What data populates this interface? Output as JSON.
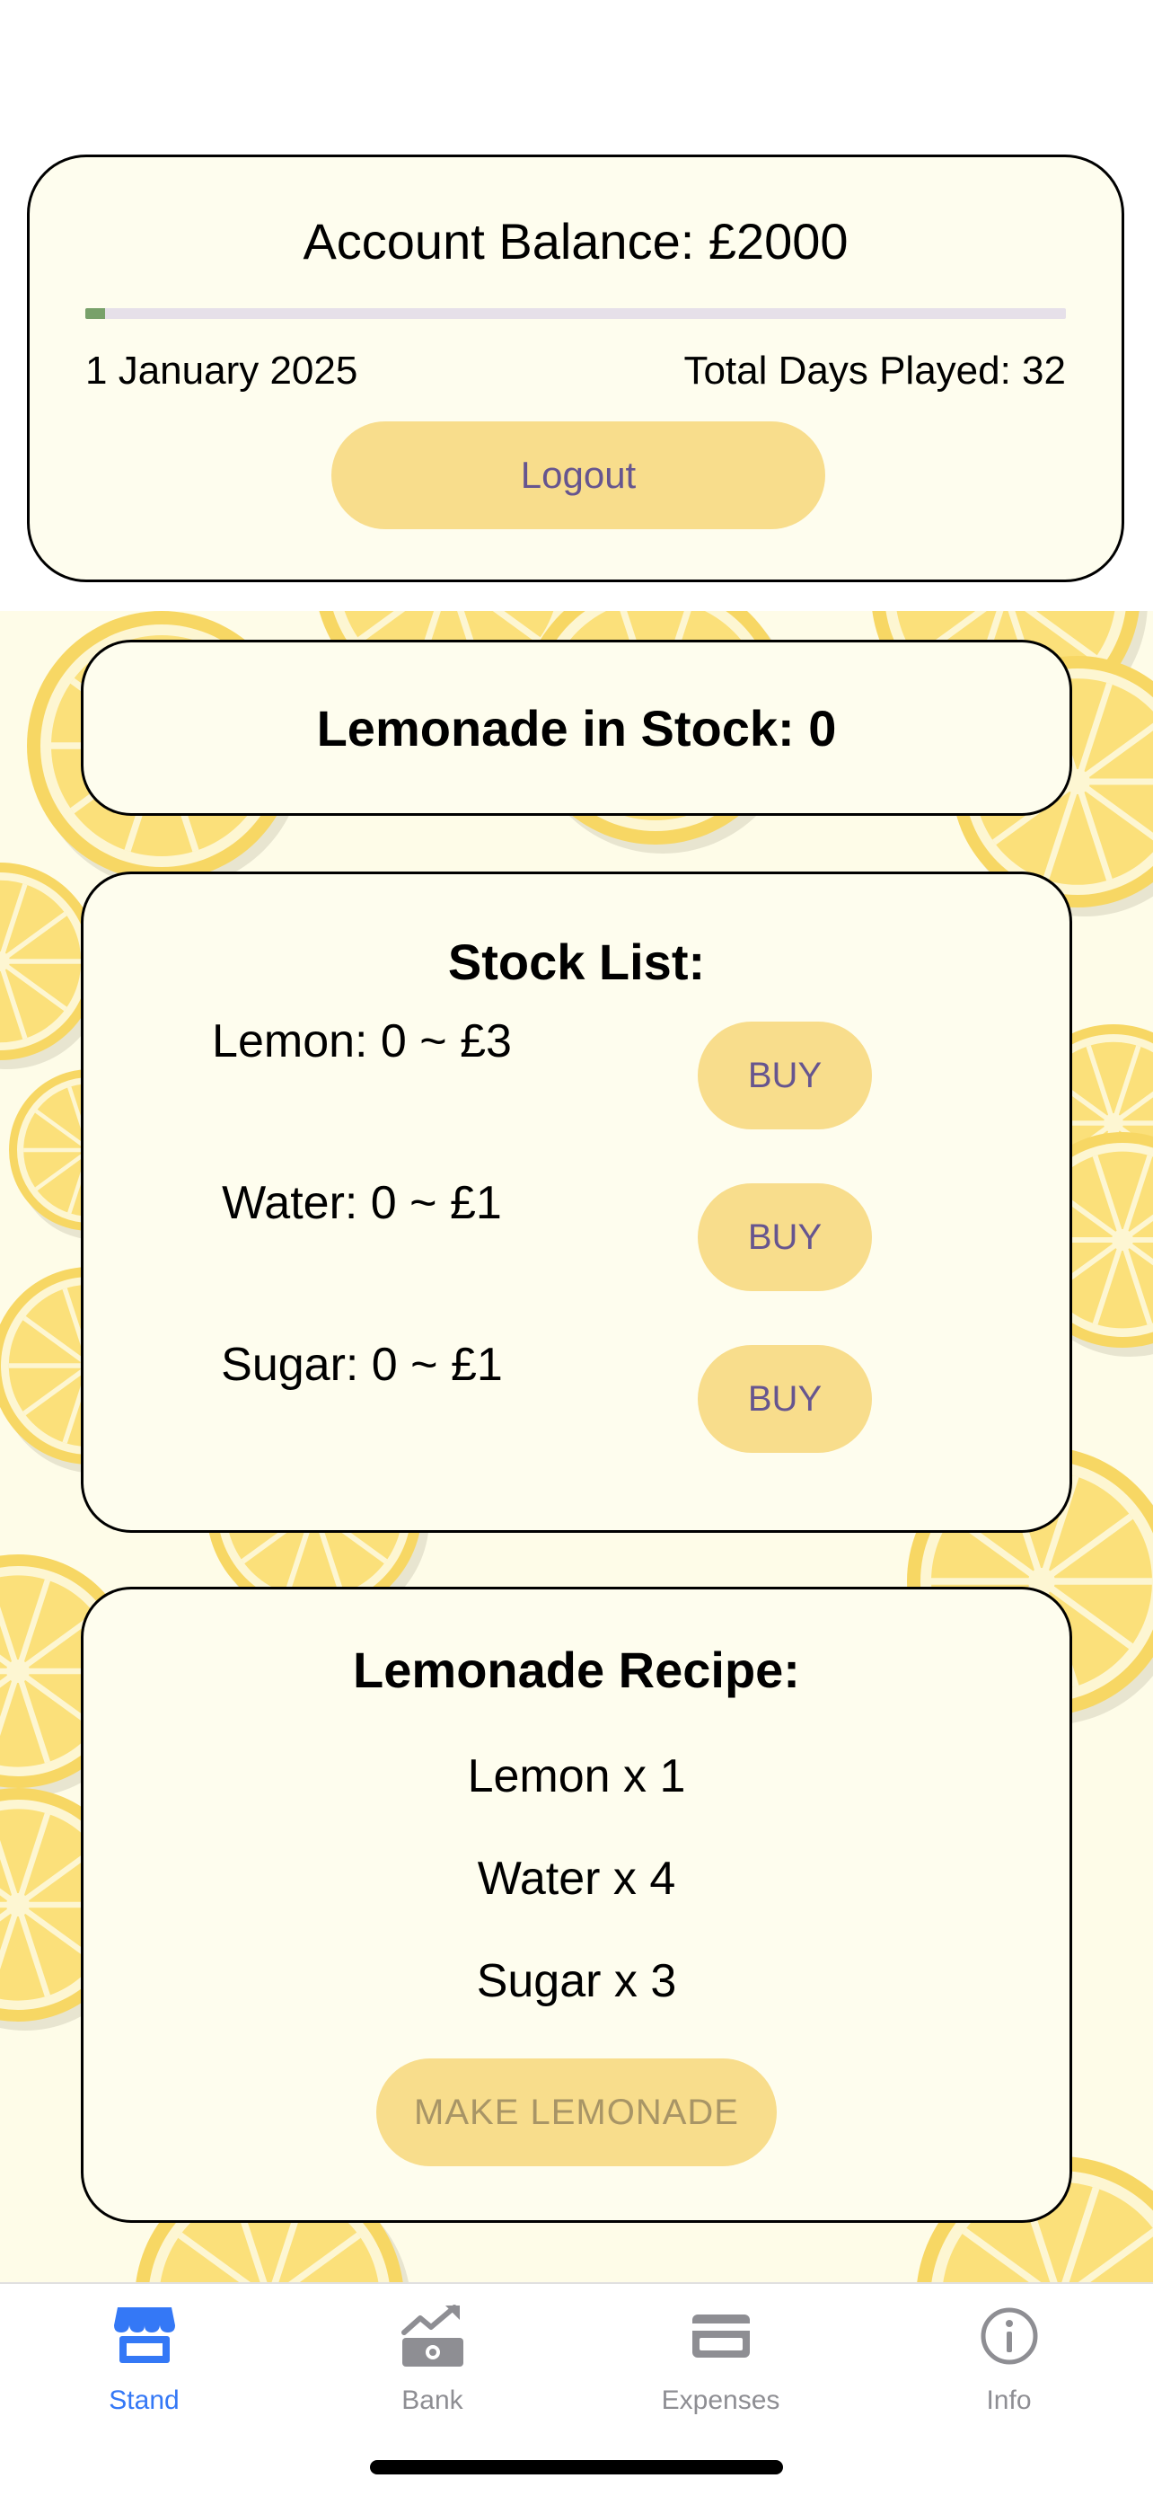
{
  "account": {
    "balance_label": "Account Balance: £2000",
    "progress": 0.02,
    "date": "1 January 2025",
    "days_played": "Total Days Played: 32",
    "logout_label": "Logout"
  },
  "stock": {
    "title": "Lemonade in Stock: 0"
  },
  "stock_list": {
    "heading": "Stock List:",
    "items": [
      {
        "label": "Lemon: 0 ~ £3",
        "button": "BUY"
      },
      {
        "label": "Water: 0 ~ £1",
        "button": "BUY"
      },
      {
        "label": "Sugar: 0 ~ £1",
        "button": "BUY"
      }
    ]
  },
  "recipe": {
    "heading": "Lemonade Recipe:",
    "lines": [
      "Lemon x 1",
      "Water x 4",
      "Sugar x 3"
    ],
    "make_label": "MAKE LEMONADE"
  },
  "tabs": [
    {
      "label": "Stand",
      "icon": "storefront-icon",
      "active": true
    },
    {
      "label": "Bank",
      "icon": "bank-icon",
      "active": false
    },
    {
      "label": "Expenses",
      "icon": "credit-card-icon",
      "active": false
    },
    {
      "label": "Info",
      "icon": "info-icon",
      "active": false
    }
  ],
  "colors": {
    "accent": "#f8dd8c",
    "button_text": "#66558f",
    "card_bg": "#fefdee",
    "tab_active": "#3478f6",
    "tab_inactive": "#8e8e93",
    "progress_fill": "#78a16a"
  }
}
